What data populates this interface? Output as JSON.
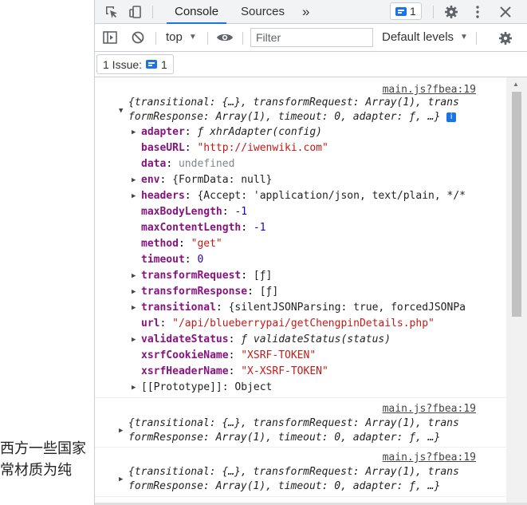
{
  "background_page": {
    "text_line_1": "西方一些国家",
    "text_line_2": "常材质为纯"
  },
  "devtools": {
    "toolbar": {
      "tabs": [
        {
          "label": "Console",
          "active": true
        },
        {
          "label": "Sources",
          "active": false
        }
      ],
      "more_tabs": "»",
      "issues_count": "1"
    },
    "console_toolbar": {
      "context": "top",
      "filter_placeholder": "Filter",
      "levels": "Default levels"
    },
    "issues_bar": {
      "label": "1 Issue:",
      "count": "1"
    },
    "entries": [
      {
        "source": "main.js?fbea:19",
        "summary_1": "{transitional: {…}, transformRequest: Array(1), trans",
        "summary_2": "formResponse: Array(1), timeout: 0, adapter: ƒ, …}",
        "expanded": true,
        "properties": [
          {
            "key": "adapter",
            "value": "ƒ xhrAdapter(config)",
            "expandable": true,
            "type": "fn"
          },
          {
            "key": "baseURL",
            "value": "\"http://iwenwiki.com\"",
            "expandable": false,
            "type": "string"
          },
          {
            "key": "data",
            "value": "undefined",
            "expandable": false,
            "type": "undefined"
          },
          {
            "key": "env",
            "value": "{FormData: null}",
            "expandable": true,
            "type": "object"
          },
          {
            "key": "headers",
            "value": "{Accept: 'application/json, text/plain, */*",
            "expandable": true,
            "type": "object"
          },
          {
            "key": "maxBodyLength",
            "value": "-1",
            "expandable": false,
            "type": "number"
          },
          {
            "key": "maxContentLength",
            "value": "-1",
            "expandable": false,
            "type": "number"
          },
          {
            "key": "method",
            "value": "\"get\"",
            "expandable": false,
            "type": "string"
          },
          {
            "key": "timeout",
            "value": "0",
            "expandable": false,
            "type": "number"
          },
          {
            "key": "transformRequest",
            "value": "[ƒ]",
            "expandable": true,
            "type": "object"
          },
          {
            "key": "transformResponse",
            "value": "[ƒ]",
            "expandable": true,
            "type": "object"
          },
          {
            "key": "transitional",
            "value": "{silentJSONParsing: true, forcedJSONPa",
            "expandable": true,
            "type": "object"
          },
          {
            "key": "url",
            "value": "\"/api/blueberrypai/getChengpinDetails.php\"",
            "expandable": false,
            "type": "string"
          },
          {
            "key": "validateStatus",
            "value": "ƒ validateStatus(status)",
            "expandable": true,
            "type": "fn"
          },
          {
            "key": "xsrfCookieName",
            "value": "\"XSRF-TOKEN\"",
            "expandable": false,
            "type": "string"
          },
          {
            "key": "xsrfHeaderName",
            "value": "\"X-XSRF-TOKEN\"",
            "expandable": false,
            "type": "string"
          }
        ],
        "prototype": "[[Prototype]]: Object"
      },
      {
        "source": "main.js?fbea:19",
        "summary_1": "{transitional: {…}, transformRequest: Array(1), trans",
        "summary_2": "formResponse: Array(1), timeout: 0, adapter: ƒ, …}",
        "expanded": false
      },
      {
        "source": "main.js?fbea:19",
        "summary_1": "{transitional: {…}, transformRequest: Array(1), trans",
        "summary_2": "formResponse: Array(1), timeout: 0, adapter: ƒ, …}",
        "expanded": false
      }
    ]
  }
}
